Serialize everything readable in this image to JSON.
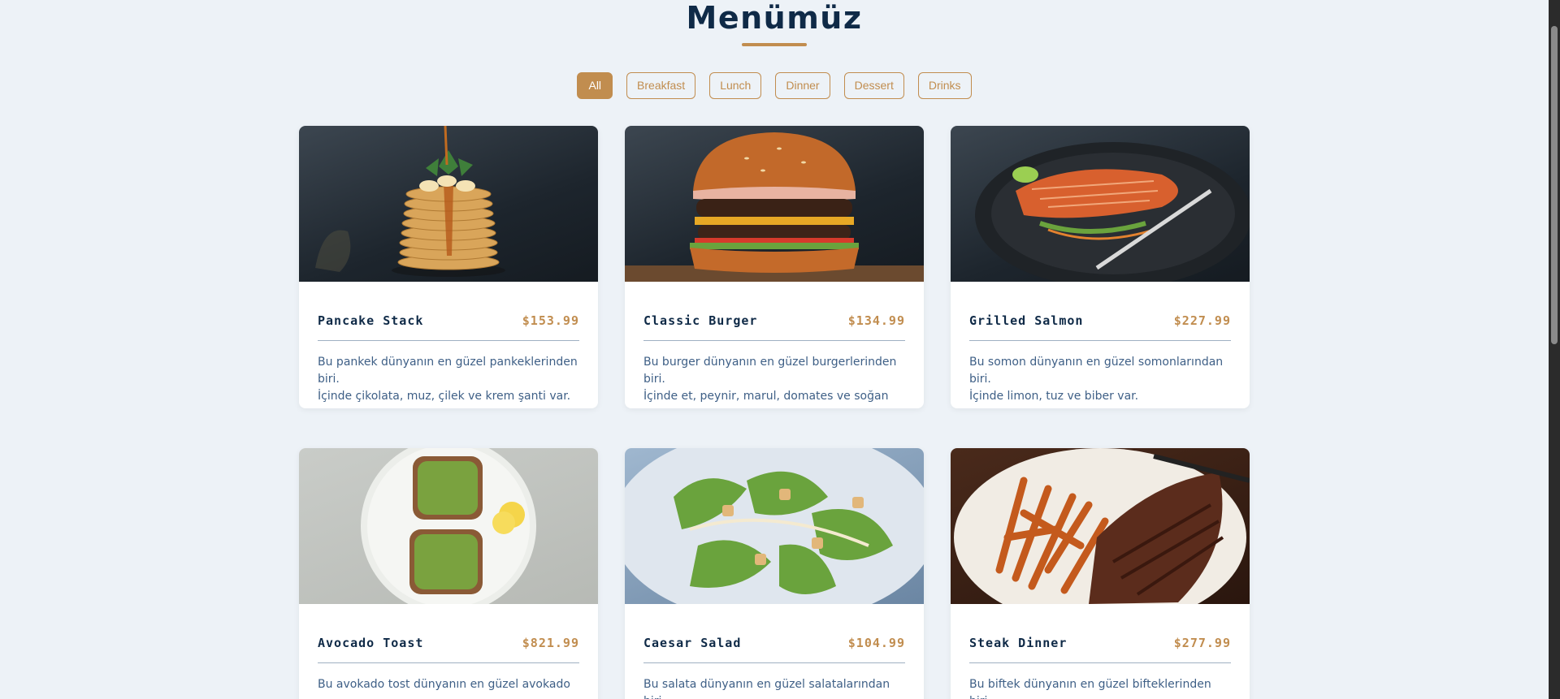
{
  "page": {
    "title": "Menümüz"
  },
  "filters": [
    {
      "label": "All",
      "active": true
    },
    {
      "label": "Breakfast",
      "active": false
    },
    {
      "label": "Lunch",
      "active": false
    },
    {
      "label": "Dinner",
      "active": false
    },
    {
      "label": "Dessert",
      "active": false
    },
    {
      "label": "Drinks",
      "active": false
    }
  ],
  "menu": {
    "items": [
      {
        "name": "Pancake Stack",
        "price": "$153.99",
        "description": "Bu pankek dünyanın en güzel pankeklerinden biri.\nİçinde çikolata, muz, çilek ve krem şanti var.",
        "image_icon": "pancake-stack-image"
      },
      {
        "name": "Classic Burger",
        "price": "$134.99",
        "description": "Bu burger dünyanın en güzel burgerlerinden biri.\nİçinde et, peynir, marul, domates ve soğan var.",
        "image_icon": "classic-burger-image"
      },
      {
        "name": "Grilled Salmon",
        "price": "$227.99",
        "description": "Bu somon dünyanın en güzel somonlarından biri.\nİçinde limon, tuz ve biber var.",
        "image_icon": "grilled-salmon-image"
      },
      {
        "name": "Avocado Toast",
        "price": "$821.99",
        "description": "Bu avokado tost dünyanın en güzel avokado",
        "image_icon": "avocado-toast-image"
      },
      {
        "name": "Caesar Salad",
        "price": "$104.99",
        "description": "Bu salata dünyanın en güzel salatalarından biri.",
        "image_icon": "caesar-salad-image"
      },
      {
        "name": "Steak Dinner",
        "price": "$277.99",
        "description": "Bu biftek dünyanın en güzel bifteklerinden biri.",
        "image_icon": "steak-dinner-image"
      }
    ]
  },
  "colors": {
    "accent": "#c18d4f",
    "heading": "#0f2a47",
    "description": "#3e5f86",
    "background": "#edf2f7"
  }
}
